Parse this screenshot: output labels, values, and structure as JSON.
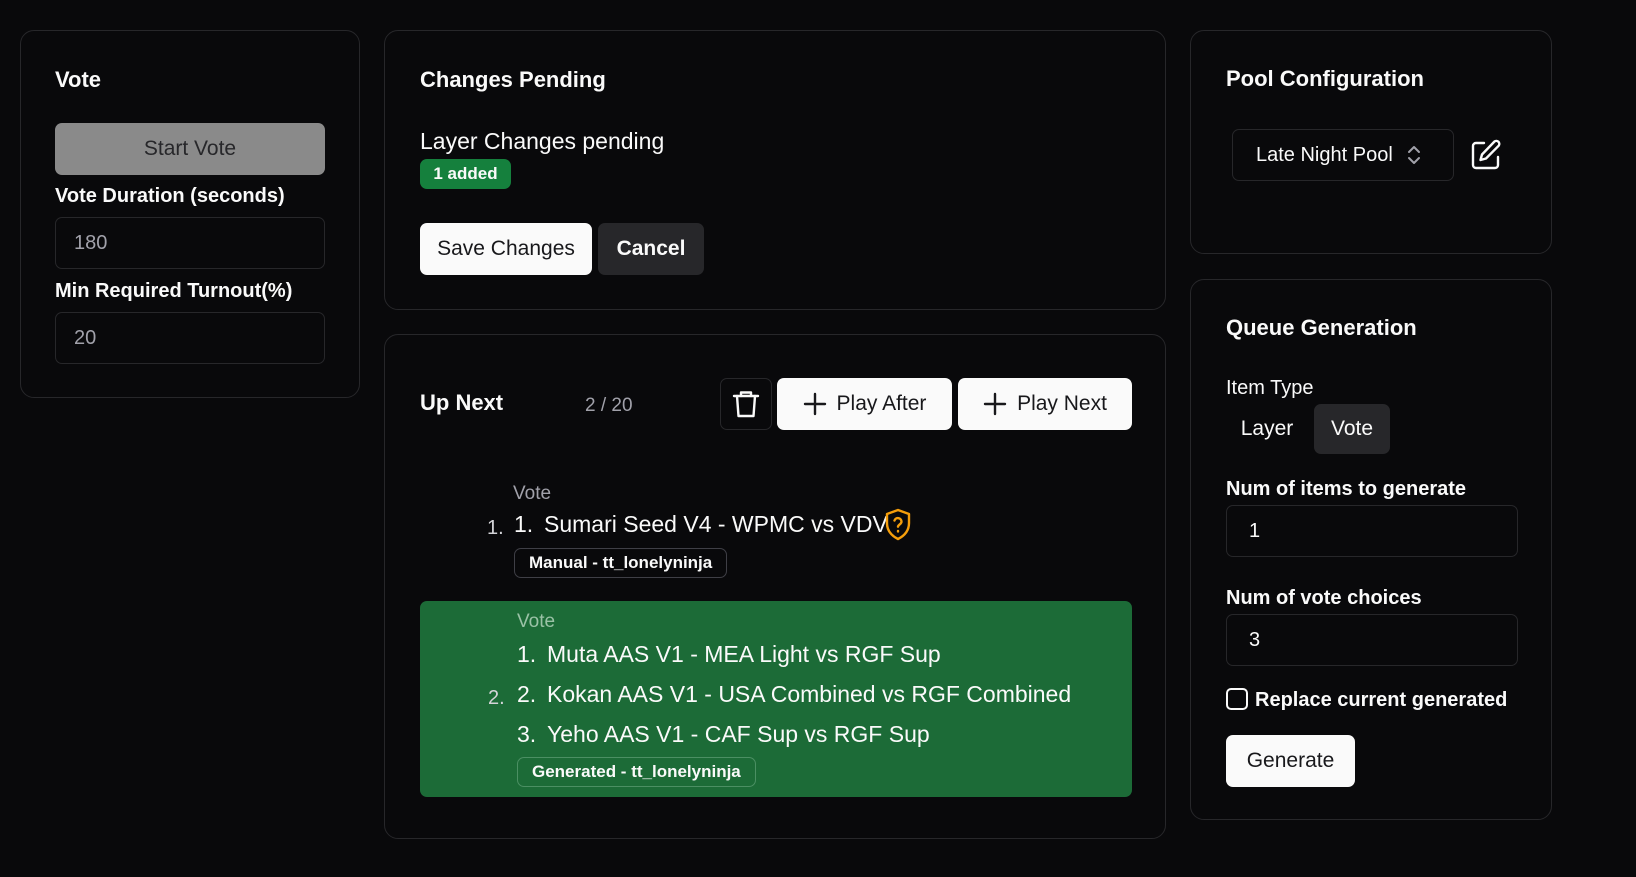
{
  "vote": {
    "title": "Vote",
    "start_button": "Start Vote",
    "duration_label": "Vote Duration (seconds)",
    "duration_value": "180",
    "turnout_label": "Min Required Turnout(%)",
    "turnout_value": "20"
  },
  "changes": {
    "title": "Changes Pending",
    "subtitle": "Layer Changes pending",
    "badge": "1 added",
    "save_button": "Save Changes",
    "cancel_button": "Cancel"
  },
  "up_next": {
    "title": "Up Next",
    "count": "2 / 20",
    "play_after_button": "Play After",
    "play_next_button": "Play Next",
    "items": [
      {
        "order": "1.",
        "type": "Vote",
        "choices": [
          {
            "num": "1.",
            "text": "Sumari Seed V4 - WPMC vs VDV"
          }
        ],
        "tag": "Manual - tt_lonelyninja"
      },
      {
        "order": "2.",
        "type": "Vote",
        "choices": [
          {
            "num": "1.",
            "text": "Muta AAS V1 - MEA Light vs RGF Sup"
          },
          {
            "num": "2.",
            "text": "Kokan AAS V1 - USA Combined vs RGF Combined"
          },
          {
            "num": "3.",
            "text": "Yeho AAS V1 - CAF Sup vs RGF Sup"
          }
        ],
        "tag": "Generated - tt_lonelyninja",
        "highlight_color": "#1c6b37"
      }
    ]
  },
  "pool": {
    "title": "Pool Configuration",
    "selected": "Late Night Pool"
  },
  "queue": {
    "title": "Queue Generation",
    "item_type_label": "Item Type",
    "item_types": [
      "Layer",
      "Vote"
    ],
    "active_item_type": "Vote",
    "num_items_label": "Num of items to generate",
    "num_items_value": "1",
    "num_choices_label": "Num of vote choices",
    "num_choices_value": "3",
    "replace_label": "Replace current generated",
    "replace_checked": false,
    "generate_button": "Generate"
  },
  "colors": {
    "background": "#09090b",
    "border": "#27272a",
    "badge_green": "#15803d",
    "highlight_green": "#1c6b37",
    "warning_orange": "#f59e0b"
  }
}
